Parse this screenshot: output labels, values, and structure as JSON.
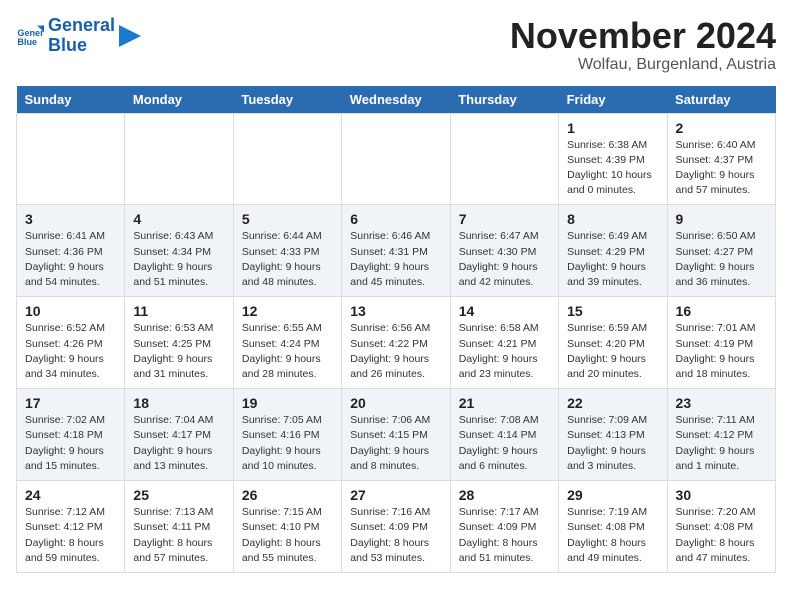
{
  "logo": {
    "line1": "General",
    "line2": "Blue"
  },
  "title": "November 2024",
  "subtitle": "Wolfau, Burgenland, Austria",
  "headers": [
    "Sunday",
    "Monday",
    "Tuesday",
    "Wednesday",
    "Thursday",
    "Friday",
    "Saturday"
  ],
  "weeks": [
    [
      {
        "day": "",
        "info": ""
      },
      {
        "day": "",
        "info": ""
      },
      {
        "day": "",
        "info": ""
      },
      {
        "day": "",
        "info": ""
      },
      {
        "day": "",
        "info": ""
      },
      {
        "day": "1",
        "info": "Sunrise: 6:38 AM\nSunset: 4:39 PM\nDaylight: 10 hours\nand 0 minutes."
      },
      {
        "day": "2",
        "info": "Sunrise: 6:40 AM\nSunset: 4:37 PM\nDaylight: 9 hours\nand 57 minutes."
      }
    ],
    [
      {
        "day": "3",
        "info": "Sunrise: 6:41 AM\nSunset: 4:36 PM\nDaylight: 9 hours\nand 54 minutes."
      },
      {
        "day": "4",
        "info": "Sunrise: 6:43 AM\nSunset: 4:34 PM\nDaylight: 9 hours\nand 51 minutes."
      },
      {
        "day": "5",
        "info": "Sunrise: 6:44 AM\nSunset: 4:33 PM\nDaylight: 9 hours\nand 48 minutes."
      },
      {
        "day": "6",
        "info": "Sunrise: 6:46 AM\nSunset: 4:31 PM\nDaylight: 9 hours\nand 45 minutes."
      },
      {
        "day": "7",
        "info": "Sunrise: 6:47 AM\nSunset: 4:30 PM\nDaylight: 9 hours\nand 42 minutes."
      },
      {
        "day": "8",
        "info": "Sunrise: 6:49 AM\nSunset: 4:29 PM\nDaylight: 9 hours\nand 39 minutes."
      },
      {
        "day": "9",
        "info": "Sunrise: 6:50 AM\nSunset: 4:27 PM\nDaylight: 9 hours\nand 36 minutes."
      }
    ],
    [
      {
        "day": "10",
        "info": "Sunrise: 6:52 AM\nSunset: 4:26 PM\nDaylight: 9 hours\nand 34 minutes."
      },
      {
        "day": "11",
        "info": "Sunrise: 6:53 AM\nSunset: 4:25 PM\nDaylight: 9 hours\nand 31 minutes."
      },
      {
        "day": "12",
        "info": "Sunrise: 6:55 AM\nSunset: 4:24 PM\nDaylight: 9 hours\nand 28 minutes."
      },
      {
        "day": "13",
        "info": "Sunrise: 6:56 AM\nSunset: 4:22 PM\nDaylight: 9 hours\nand 26 minutes."
      },
      {
        "day": "14",
        "info": "Sunrise: 6:58 AM\nSunset: 4:21 PM\nDaylight: 9 hours\nand 23 minutes."
      },
      {
        "day": "15",
        "info": "Sunrise: 6:59 AM\nSunset: 4:20 PM\nDaylight: 9 hours\nand 20 minutes."
      },
      {
        "day": "16",
        "info": "Sunrise: 7:01 AM\nSunset: 4:19 PM\nDaylight: 9 hours\nand 18 minutes."
      }
    ],
    [
      {
        "day": "17",
        "info": "Sunrise: 7:02 AM\nSunset: 4:18 PM\nDaylight: 9 hours\nand 15 minutes."
      },
      {
        "day": "18",
        "info": "Sunrise: 7:04 AM\nSunset: 4:17 PM\nDaylight: 9 hours\nand 13 minutes."
      },
      {
        "day": "19",
        "info": "Sunrise: 7:05 AM\nSunset: 4:16 PM\nDaylight: 9 hours\nand 10 minutes."
      },
      {
        "day": "20",
        "info": "Sunrise: 7:06 AM\nSunset: 4:15 PM\nDaylight: 9 hours\nand 8 minutes."
      },
      {
        "day": "21",
        "info": "Sunrise: 7:08 AM\nSunset: 4:14 PM\nDaylight: 9 hours\nand 6 minutes."
      },
      {
        "day": "22",
        "info": "Sunrise: 7:09 AM\nSunset: 4:13 PM\nDaylight: 9 hours\nand 3 minutes."
      },
      {
        "day": "23",
        "info": "Sunrise: 7:11 AM\nSunset: 4:12 PM\nDaylight: 9 hours\nand 1 minute."
      }
    ],
    [
      {
        "day": "24",
        "info": "Sunrise: 7:12 AM\nSunset: 4:12 PM\nDaylight: 8 hours\nand 59 minutes."
      },
      {
        "day": "25",
        "info": "Sunrise: 7:13 AM\nSunset: 4:11 PM\nDaylight: 8 hours\nand 57 minutes."
      },
      {
        "day": "26",
        "info": "Sunrise: 7:15 AM\nSunset: 4:10 PM\nDaylight: 8 hours\nand 55 minutes."
      },
      {
        "day": "27",
        "info": "Sunrise: 7:16 AM\nSunset: 4:09 PM\nDaylight: 8 hours\nand 53 minutes."
      },
      {
        "day": "28",
        "info": "Sunrise: 7:17 AM\nSunset: 4:09 PM\nDaylight: 8 hours\nand 51 minutes."
      },
      {
        "day": "29",
        "info": "Sunrise: 7:19 AM\nSunset: 4:08 PM\nDaylight: 8 hours\nand 49 minutes."
      },
      {
        "day": "30",
        "info": "Sunrise: 7:20 AM\nSunset: 4:08 PM\nDaylight: 8 hours\nand 47 minutes."
      }
    ]
  ]
}
